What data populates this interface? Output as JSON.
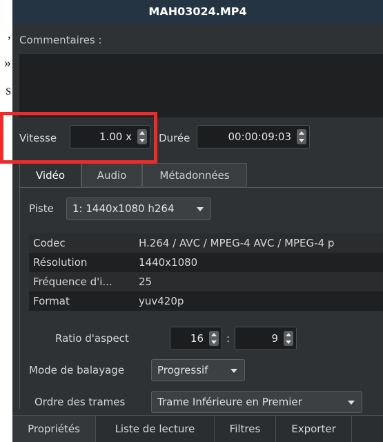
{
  "left_doc": {
    "fragments": [
      ",",
      "»",
      "s"
    ]
  },
  "window": {
    "title": "MAH03024.MP4"
  },
  "comments": {
    "label": "Commentaires :",
    "value": ""
  },
  "speed": {
    "label": "Vitesse",
    "value": "1.00 x"
  },
  "duration": {
    "label": "Durée",
    "value": "00:00:09:03"
  },
  "tabs": [
    {
      "label": "Vidéo",
      "active": true
    },
    {
      "label": "Audio",
      "active": false
    },
    {
      "label": "Métadonnées",
      "active": false
    }
  ],
  "track": {
    "label": "Piste",
    "value": "1: 1440x1080 h264"
  },
  "info_rows": [
    {
      "key": "Codec",
      "value": "H.264 / AVC / MPEG-4 AVC / MPEG-4 p"
    },
    {
      "key": "Résolution",
      "value": "1440x1080"
    },
    {
      "key": "Fréquence d'i...",
      "value": "25"
    },
    {
      "key": "Format",
      "value": "yuv420p"
    }
  ],
  "aspect": {
    "label": "Ratio d'aspect",
    "num": "16",
    "separator": ":",
    "den": "9"
  },
  "scan_mode": {
    "label": "Mode de balayage",
    "value": "Progressif"
  },
  "field_order": {
    "label": "Ordre des trames",
    "value": "Trame Inférieure en Premier"
  },
  "bottom_tabs": [
    {
      "label": "Propriétés",
      "active": true
    },
    {
      "label": "Liste de lecture",
      "active": false
    },
    {
      "label": "Filtres",
      "active": false
    },
    {
      "label": "Exporter",
      "active": false
    }
  ],
  "colors": {
    "panel_bg": "#2f3234",
    "titlebar_bg": "#243442",
    "highlight": "#ee2a2a"
  }
}
